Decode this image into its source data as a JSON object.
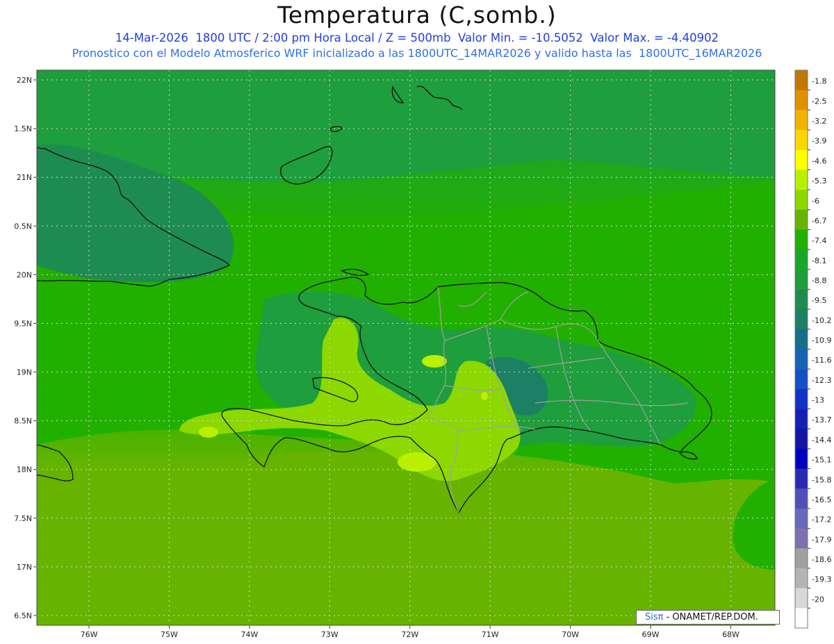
{
  "title": "Temperatura (C,somb.)",
  "subtitle_line1": "14-Mar-2026  1800 UTC / 2:00 pm Hora Local / Z = 500mb  Valor Min. = -10.5052  Valor Max. = -4.40902",
  "subtitle_line2": "Pronostico con el Modelo Atmosferico WRF inicializado a las 1800UTC_14MAR2026 y valido hasta las  1800UTC_16MAR2026",
  "credit": {
    "brand": "Sisπ",
    "text": "- ONAMET/REP.DOM."
  },
  "chart_data": {
    "type": "heatmap",
    "variable": "Temperatura (C,somb.)",
    "level": "500mb",
    "valid_time": "14-Mar-2026 1800 UTC",
    "value_min": -10.5052,
    "value_max": -4.40902,
    "lon_range": [
      -76.65,
      -67.45
    ],
    "lat_range": [
      16.4,
      22.1
    ],
    "x_ticks": [
      "76W",
      "75W",
      "74W",
      "73W",
      "72W",
      "71W",
      "70W",
      "69W",
      "68W"
    ],
    "y_ticks": [
      "22N",
      "1.5N",
      "21N",
      "0.5N",
      "20N",
      "9.5N",
      "19N",
      "8.5N",
      "18N",
      "7.5N",
      "17N",
      "6.5N"
    ],
    "grid": true,
    "colorbar": {
      "labels": [
        "-1.8",
        "-2.5",
        "-3.2",
        "-3.9",
        "-4.6",
        "-5.3",
        "-6",
        "-6.7",
        "-7.4",
        "-8.1",
        "-8.8",
        "-9.5",
        "-10.2",
        "-10.9",
        "-11.6",
        "-12.3",
        "-13",
        "-13.7",
        "-14.4",
        "-15.1",
        "-15.8",
        "-16.5",
        "-17.2",
        "-17.9",
        "-18.6",
        "-19.3",
        "-20"
      ],
      "colors": [
        "#c07800",
        "#e09000",
        "#f0b400",
        "#f8d800",
        "#ffff00",
        "#b8f000",
        "#8cd800",
        "#66b400",
        "#22b000",
        "#18a828",
        "#1e9e3c",
        "#1e8c50",
        "#1c8064",
        "#146e8c",
        "#1464b4",
        "#1450c8",
        "#1432c8",
        "#1420b4",
        "#1414a0",
        "#0000c0",
        "#2a2ab0",
        "#5050b8",
        "#6868b8",
        "#8070b0",
        "#a0a0a0",
        "#b4b4b4",
        "#d8d8d8",
        "#ffffff"
      ]
    },
    "field_colors": {
      "base_north": "#1e9e3c",
      "base_mid": "#22b000",
      "base_south": "#66b400",
      "cool_patch": "#1e8c50",
      "cold_patch": "#1c8064",
      "warm_patch": "#8cd800",
      "warmest_patch": "#b8f000",
      "coastline": "#111111",
      "province_border": "#a0a0a0",
      "gridline": "#d8d8d8"
    }
  }
}
